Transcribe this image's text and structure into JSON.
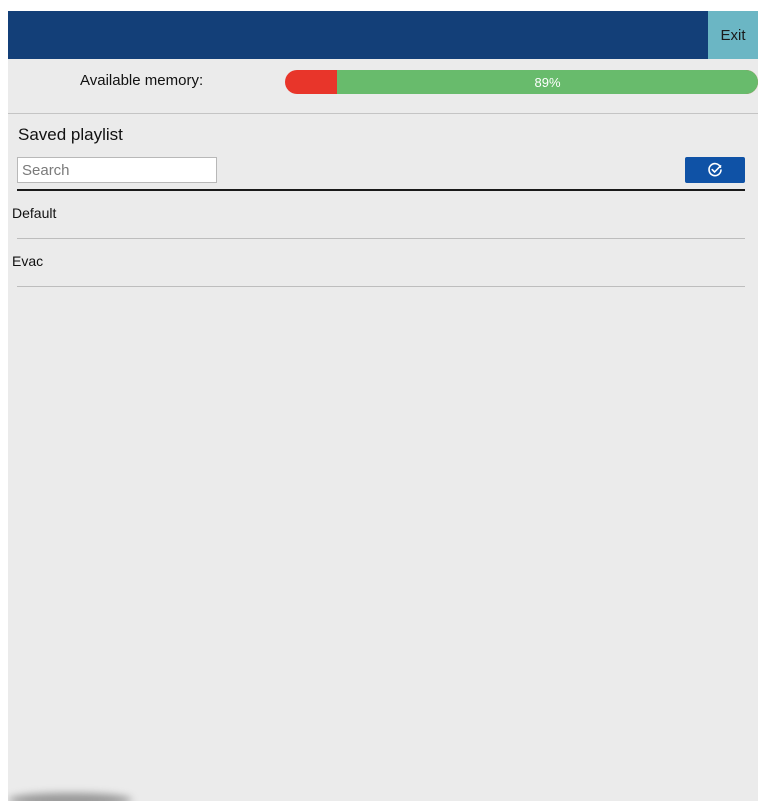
{
  "header": {
    "exit_label": "Exit"
  },
  "memory": {
    "label": "Available memory:",
    "percent_text": "89%",
    "available_fraction": 0.89,
    "used_color": "#e8352a",
    "available_color": "#68bb6c"
  },
  "playlist": {
    "title": "Saved playlist",
    "search_placeholder": "Search",
    "confirm_icon": "check-circle-icon",
    "items": [
      {
        "label": "Default"
      },
      {
        "label": "Evac"
      }
    ]
  },
  "colors": {
    "topbar": "#133f78",
    "exit_button": "#6bb6c4",
    "confirm_button": "#0f52a6",
    "background": "#ebebeb"
  }
}
